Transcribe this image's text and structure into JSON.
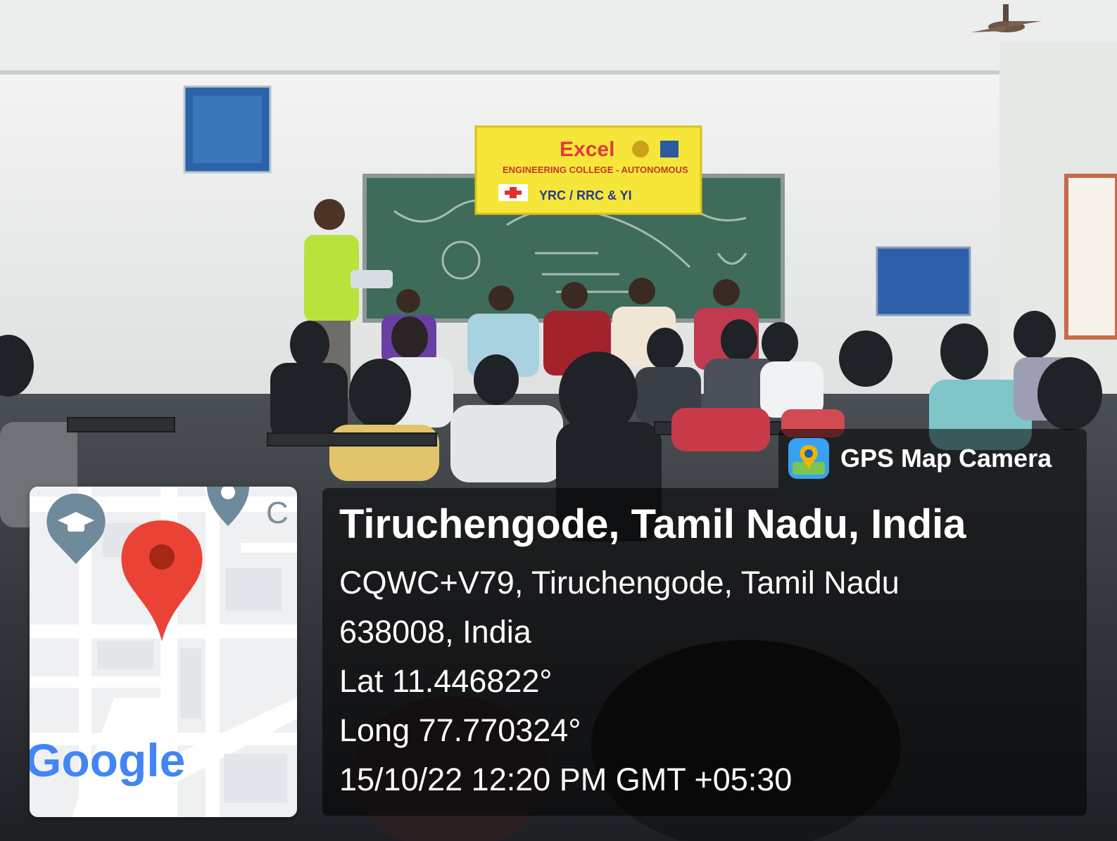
{
  "overlay": {
    "app_name": "GPS Map Camera",
    "location_title": "Tiruchengode, Tamil Nadu, India",
    "address_line_1": "CQWC+V79, Tiruchengode, Tamil Nadu",
    "address_line_2": "638008, India",
    "latitude": "Lat 11.446822°",
    "longitude": "Long 77.770324°",
    "timestamp": "15/10/22 12:20 PM GMT +05:30"
  },
  "map": {
    "logo_text": "Google",
    "partial_label": "C",
    "pin_color": "#ea4335",
    "poi_color": "#6f8a9a"
  },
  "banner": {
    "college_name": "Excel",
    "subtitle": "ENGINEERING COLLEGE - AUTONOMOUS",
    "clubs": "YRC / RRC & YI",
    "bg_color": "#f6e63a"
  },
  "colors": {
    "overlay_bg": "rgba(0,0,0,0.55)",
    "wall": "#e9ebea",
    "chalkboard": "#3f6b5a"
  }
}
